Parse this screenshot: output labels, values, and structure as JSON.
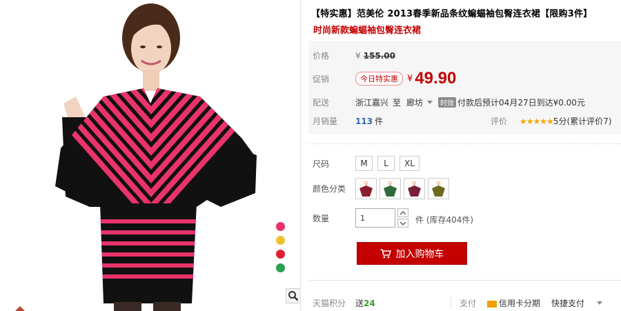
{
  "product": {
    "title": "【特实惠】范美伦 2013春季新品条纹蝙蝠袖包臀连衣裙【限购3件】",
    "subtitle": "时尚新款蝙蝠袖包臀连衣裙"
  },
  "price": {
    "orig_label": "价格",
    "yen": "¥",
    "orig_price": "155.00",
    "promo_label": "促销",
    "promo_tag": "今日特实惠",
    "promo_price": "49.90"
  },
  "shipping": {
    "label": "配送",
    "from": "浙江嘉兴",
    "to_word": "至",
    "destination": "廊坊",
    "badge": "时效",
    "info": "付款后预计04月27日到达¥0.00元"
  },
  "sales": {
    "label": "月销量",
    "count": "113",
    "unit": "件",
    "rating_label": "评价",
    "stars": "★★★★★",
    "rating_text": "5分(累计评价7)"
  },
  "size": {
    "label": "尺码",
    "options": [
      "M",
      "L",
      "XL"
    ]
  },
  "color": {
    "label": "颜色分类",
    "swatches": [
      "#8b1e2e",
      "#2f6b3a",
      "#7a1f3a",
      "#6b6a1e"
    ]
  },
  "quantity": {
    "label": "数量",
    "value": "1",
    "stock": "件 (库存404件)"
  },
  "cart": {
    "label": "加入购物车"
  },
  "footer": {
    "points_label": "天猫积分",
    "points_prefix": "送",
    "points_value": "24",
    "pay_label": "支付",
    "card_pay": "信用卡分期",
    "quick_pay": "快捷支付"
  },
  "gallery": {
    "dot_colors": [
      "#e8336b",
      "#f0c030",
      "#e02030",
      "#2aa050"
    ]
  }
}
